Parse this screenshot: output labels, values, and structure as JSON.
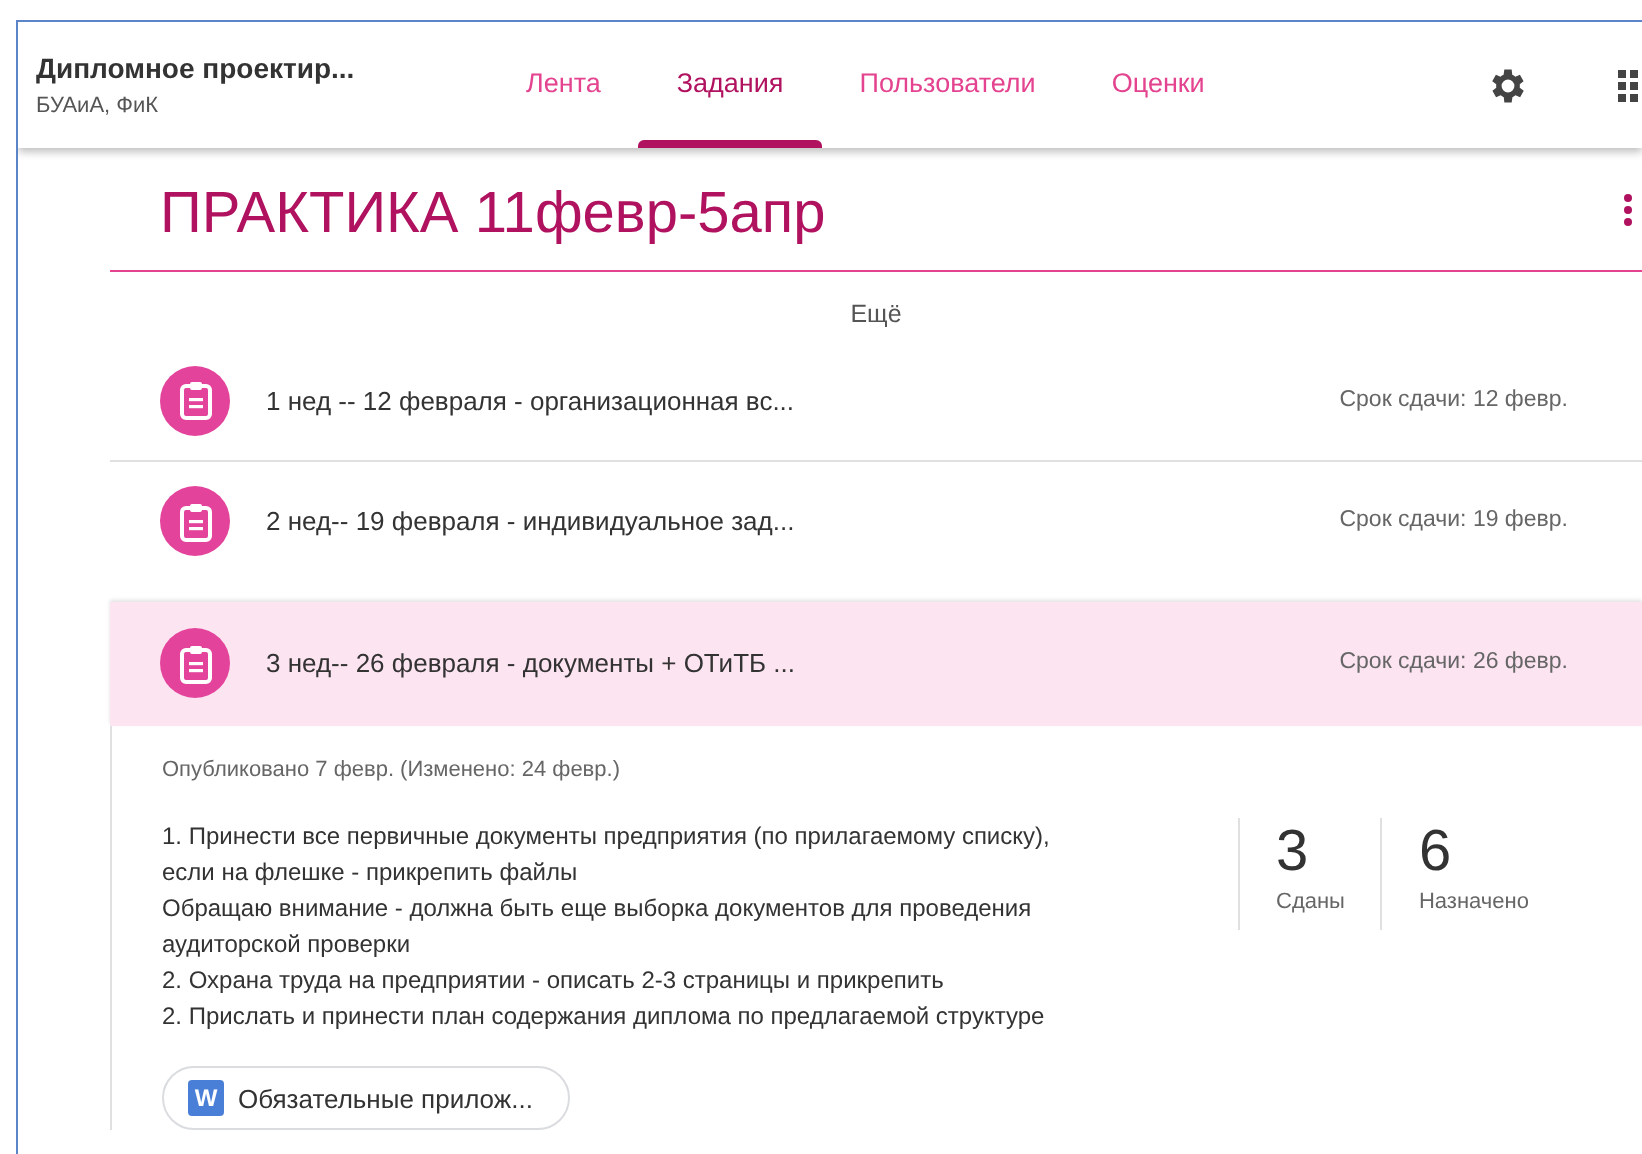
{
  "header": {
    "course_title": "Дипломное проектир...",
    "course_subtitle": "БУАиА, ФиК",
    "tabs": [
      {
        "label": "Лента",
        "selected": false
      },
      {
        "label": "Задания",
        "selected": true
      },
      {
        "label": "Пользователи",
        "selected": false
      },
      {
        "label": "Оценки",
        "selected": false
      }
    ]
  },
  "topic": {
    "title": "ПРАКТИКА 11февр-5апр"
  },
  "more_link": "Ещё",
  "assignments": [
    {
      "title": "1 нед -- 12 февраля - организационная вс...",
      "due": "Срок сдачи: 12 февр.",
      "selected": false
    },
    {
      "title": "2 нед-- 19 февраля - индивидуальное зад...",
      "due": "Срок сдачи: 19 февр.",
      "selected": false
    },
    {
      "title": "3 нед-- 26 февраля - документы + ОТиТБ ...",
      "due": "Срок сдачи: 26 февр.",
      "selected": true,
      "details": {
        "published": "Опубликовано 7 февр. (Изменено: 24 февр.)",
        "description": [
          "1. Принести все первичные документы предприятия (по прилагаемому списку),",
          "если на флешке - прикрепить файлы",
          "Обращаю внимание - должна быть еще выборка документов для проведения",
          "аудиторской проверки",
          "2. Охрана труда на предприятии - описать 2-3 страницы и прикрепить",
          "2. Прислать и принести план содержания диплома по предлагаемой структуре"
        ],
        "stats": [
          {
            "count": "3",
            "label": "Сданы"
          },
          {
            "count": "6",
            "label": "Назначено"
          }
        ],
        "attachment": {
          "badge": "W",
          "name": "Обязательные прилож..."
        }
      }
    }
  ]
}
